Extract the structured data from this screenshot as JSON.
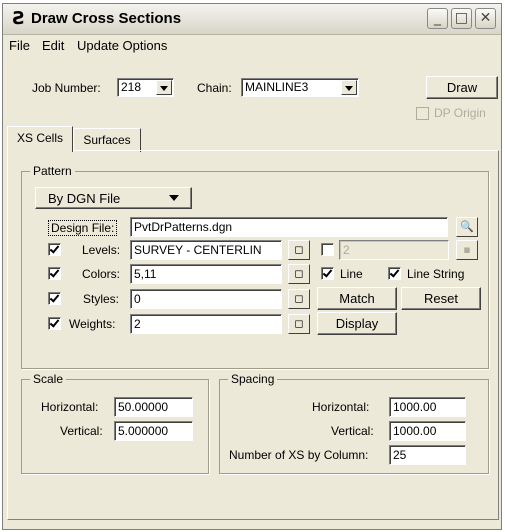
{
  "window": {
    "title": "Draw Cross Sections",
    "app_icon": "bentley-b-icon",
    "controls": [
      "minimize-icon",
      "maximize-icon",
      "close-icon"
    ]
  },
  "menu": {
    "items": [
      "File",
      "Edit",
      "Update Options"
    ]
  },
  "header": {
    "job_number_label": "Job Number:",
    "job_number_value": "218",
    "chain_label": "Chain:",
    "chain_value": "MAINLINE3",
    "draw_label": "Draw",
    "dp_origin_label": "DP Origin"
  },
  "tabs": {
    "items": [
      "XS Cells",
      "Surfaces"
    ],
    "active": "XS Cells"
  },
  "pattern": {
    "group_title": "Pattern",
    "mode_value": "By DGN File",
    "design_file_label": "Design File:",
    "design_file_value": "PvtDrPatterns.dgn",
    "levels_label": "Levels:",
    "levels_value": "SURVEY - CENTERLIN",
    "levels_checked": true,
    "levels_extra_value": "2",
    "colors_label": "Colors:",
    "colors_value": "5,11",
    "colors_checked": true,
    "styles_label": "Styles:",
    "styles_value": "0",
    "styles_checked": true,
    "weights_label": "Weights:",
    "weights_value": "2",
    "weights_checked": true,
    "line_label": "Line",
    "line_string_label": "Line String",
    "match_label": "Match",
    "reset_label": "Reset",
    "display_label": "Display"
  },
  "scale": {
    "group_title": "Scale",
    "horizontal_label": "Horizontal:",
    "horizontal_value": "50.00000",
    "vertical_label": "Vertical:",
    "vertical_value": "5.000000"
  },
  "spacing": {
    "group_title": "Spacing",
    "horizontal_label": "Horizontal:",
    "horizontal_value": "1000.00",
    "vertical_label": "Vertical:",
    "vertical_value": "1000.00",
    "number_label": "Number of XS by Column:",
    "number_value": "25"
  }
}
